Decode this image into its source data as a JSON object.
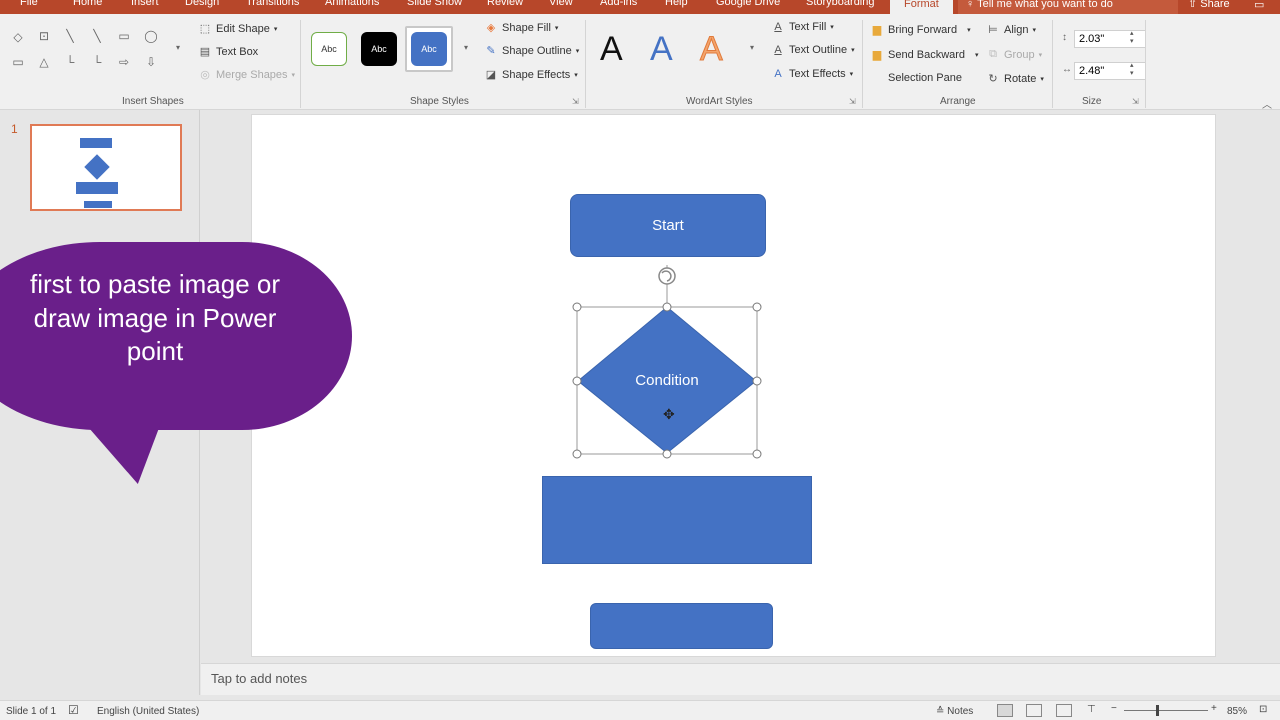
{
  "tabs": [
    "File",
    "Home",
    "Insert",
    "Design",
    "Transitions",
    "Animations",
    "Slide Show",
    "Review",
    "View",
    "Add-ins",
    "Help",
    "Google Drive",
    "Storyboarding",
    "Format"
  ],
  "tell_me": "Tell me what you want to do",
  "share": "Share",
  "ribbon": {
    "insert_shapes": {
      "label": "Insert Shapes",
      "edit_shape": "Edit Shape",
      "text_box": "Text Box",
      "merge_shapes": "Merge Shapes"
    },
    "shape_styles": {
      "label": "Shape Styles",
      "swatch_text": "Abc",
      "shape_fill": "Shape Fill",
      "shape_outline": "Shape Outline",
      "shape_effects": "Shape Effects"
    },
    "wordart_styles": {
      "label": "WordArt Styles",
      "glyph": "A",
      "text_fill": "Text Fill",
      "text_outline": "Text Outline",
      "text_effects": "Text Effects"
    },
    "arrange": {
      "label": "Arrange",
      "bring_forward": "Bring Forward",
      "send_backward": "Send Backward",
      "selection_pane": "Selection Pane",
      "align": "Align",
      "group": "Group",
      "rotate": "Rotate"
    },
    "size": {
      "label": "Size",
      "height": "2.03\"",
      "width": "2.48\""
    }
  },
  "thumbnail": {
    "slide_number": "1"
  },
  "callout_text": "first to paste image or draw image in Power point",
  "slide": {
    "start_label": "Start",
    "condition_label": "Condition"
  },
  "notes_placeholder": "Tap to add notes",
  "status": {
    "slide_info": "Slide 1 of 1",
    "language": "English (United States)",
    "notes": "Notes",
    "zoom": "85%"
  },
  "colors": {
    "accent": "#b7472a",
    "shape_fill": "#4472c4",
    "callout": "#6a1f8a"
  }
}
